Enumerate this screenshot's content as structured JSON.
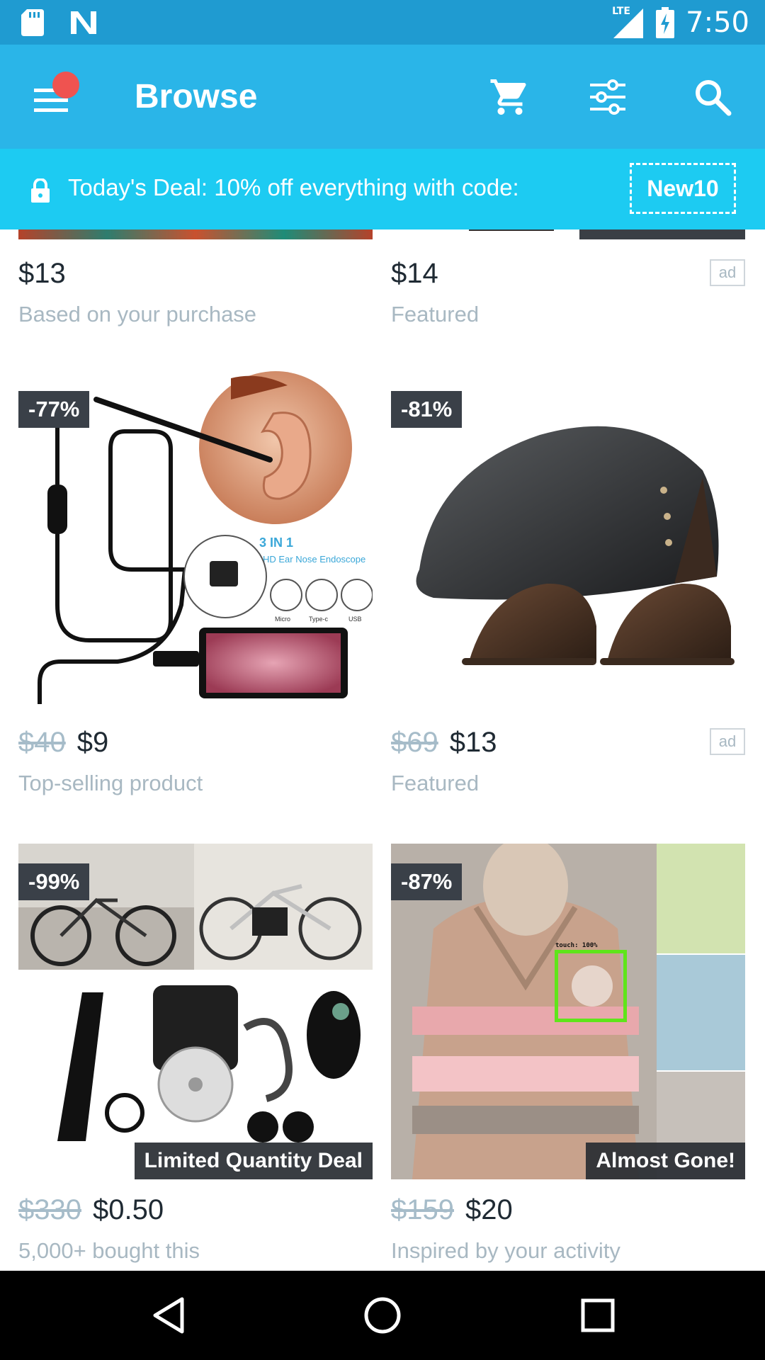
{
  "status_bar": {
    "time": "7:50",
    "network": "LTE",
    "icons": [
      "sd-card-icon",
      "notification-n-icon",
      "lte-signal-icon",
      "battery-charging-icon"
    ]
  },
  "app_bar": {
    "title": "Browse",
    "icons": [
      "menu-icon",
      "cart-icon",
      "filter-icon",
      "search-icon"
    ],
    "notification_dot_color": "#ef5350",
    "background": "#2ab5e8"
  },
  "deal_banner": {
    "text": "Today's Deal: 10% off everything with code:",
    "code": "New10",
    "background": "#1dcbf2"
  },
  "products": {
    "top_left": {
      "price": "$13",
      "subtitle": "Based on your purchase"
    },
    "top_right": {
      "price": "$14",
      "subtitle": "Featured",
      "ad_label": "ad"
    },
    "row2_left": {
      "discount": "-77%",
      "old_price": "$40",
      "price": "$9",
      "subtitle": "Top-selling product",
      "image_labels": [
        "3 IN 1",
        "HD Ear Nose Endoscope",
        "Micro",
        "Type-c",
        "USB"
      ]
    },
    "row2_right": {
      "discount": "-81%",
      "old_price": "$69",
      "price": "$13",
      "subtitle": "Featured",
      "ad_label": "ad"
    },
    "row3_left": {
      "discount": "-99%",
      "promo_label": "Limited Quantity Deal",
      "old_price": "$330",
      "price": "$0.50",
      "subtitle": "5,000+ bought this"
    },
    "row3_right": {
      "discount": "-87%",
      "promo_label": "Almost Gone!",
      "old_price": "$159",
      "price": "$20",
      "subtitle": "Inspired by your activity",
      "touch_indicator": "touch: 100%"
    }
  },
  "nav_bar": {
    "buttons": [
      "back-icon",
      "home-icon",
      "recents-icon"
    ]
  }
}
